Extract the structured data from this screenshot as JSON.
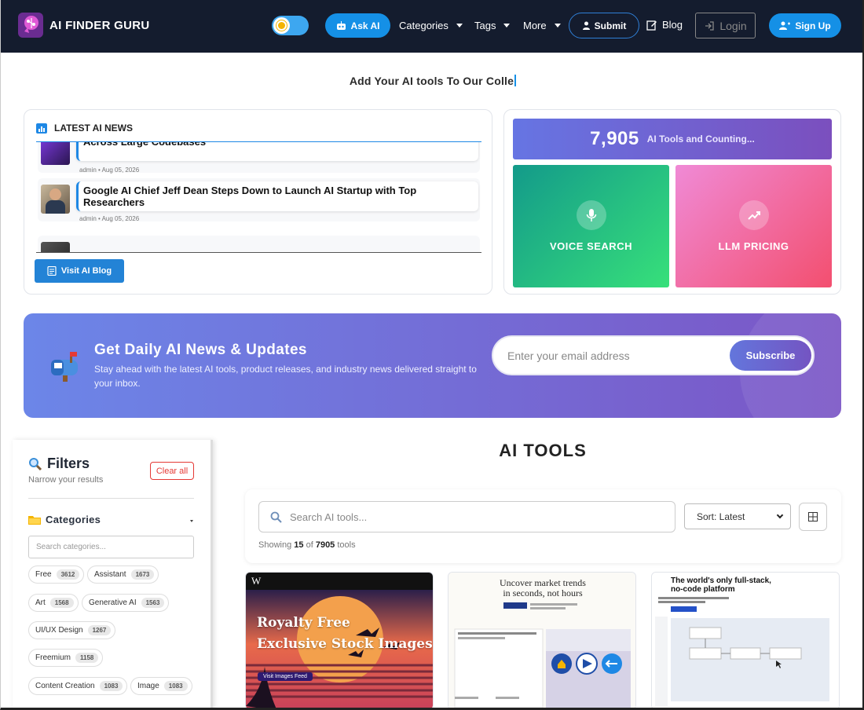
{
  "nav": {
    "brand": "AI FINDER GURU",
    "ask_ai": "Ask AI",
    "menus": [
      "Categories",
      "Tags",
      "More"
    ],
    "submit": "Submit",
    "blog": "Blog",
    "login": "Login",
    "signup": "Sign Up"
  },
  "headline": "Add Your AI tools To Our Colle",
  "news": {
    "title": "LATEST AI NEWS",
    "items": [
      {
        "title": "Across Large Codebases",
        "meta": "admin • Aug 05, 2026"
      },
      {
        "title": "Google AI Chief Jeff Dean Steps Down to Launch AI Startup with Top Researchers",
        "meta": "admin • Aug 05, 2026"
      }
    ],
    "visit_button": "Visit AI Blog"
  },
  "stats": {
    "count": "7,905",
    "count_label": "AI Tools and Counting...",
    "voice_search": "VOICE SEARCH",
    "llm_pricing": "LLM PRICING"
  },
  "newsletter": {
    "title": "Get Daily AI News & Updates",
    "subtitle": "Stay ahead with the latest AI tools, product releases, and industry news delivered straight to your inbox.",
    "placeholder": "Enter your email address",
    "button": "Subscribe"
  },
  "filters": {
    "title": "Filters",
    "subtitle": "Narrow your results",
    "clear": "Clear all",
    "categories_heading": "Categories",
    "search_placeholder": "Search categories...",
    "chips": [
      {
        "label": "Free",
        "count": "3612"
      },
      {
        "label": "Assistant",
        "count": "1673"
      },
      {
        "label": "Art",
        "count": "1568"
      },
      {
        "label": "Generative AI",
        "count": "1563"
      },
      {
        "label": "UI/UX Design",
        "count": "1267"
      },
      {
        "label": "Freemium",
        "count": "1158"
      },
      {
        "label": "Content Creation",
        "count": "1083"
      },
      {
        "label": "Image",
        "count": "1083"
      }
    ]
  },
  "tools": {
    "title": "AI TOOLS",
    "search_placeholder": "Search AI tools...",
    "sort": "Sort: Latest",
    "showing_prefix": "Showing",
    "showing_count": "15",
    "showing_of": "of",
    "showing_total": "7905",
    "showing_suffix": "tools",
    "cards": [
      {
        "headline1": "Royalty Free",
        "headline2": "Exclusive Stock Images",
        "cta": "Visit Images Feed",
        "badge": "W"
      },
      {
        "headline1": "Uncover market trends",
        "headline2": "in seconds, not hours"
      },
      {
        "headline1": "The world's only full-stack,",
        "headline2": "no-code platform"
      }
    ]
  },
  "colors": {
    "nav_bg": "#141c2e",
    "accent": "#1590e6",
    "newsletter_start": "#6c86e8",
    "newsletter_end": "#7b56c6"
  }
}
